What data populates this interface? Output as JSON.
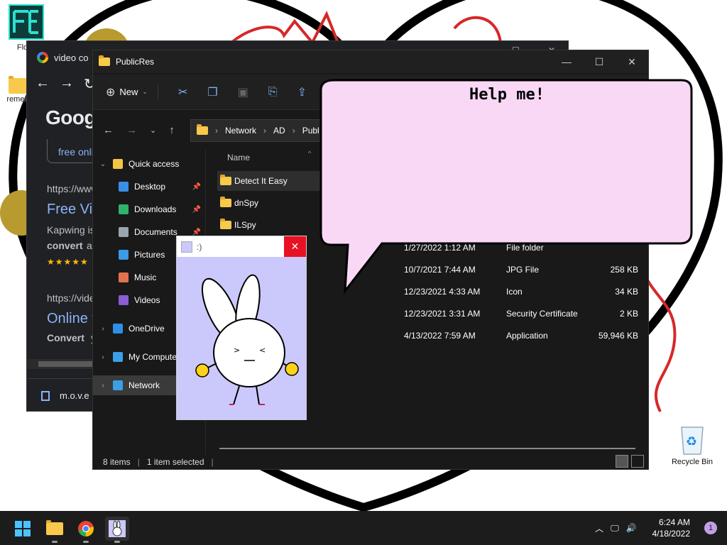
{
  "desktop": {
    "icons": [
      {
        "label": "Flowf",
        "icon": "flowframes-app-icon"
      },
      {
        "label": "remen",
        "icon": "folder-icon"
      }
    ],
    "recycle_bin": {
      "label": "Recycle Bin"
    }
  },
  "chrome": {
    "tab_title": "video co",
    "google_text": "Goog",
    "free_online": "free onli",
    "results": [
      {
        "url": "https://www",
        "title": "Free Vi",
        "snippet": "Kapwing is",
        "snippet_bold": "convert",
        "snippet_rest": "ar",
        "stars": "★★★★★"
      },
      {
        "url": "https://vide",
        "title": "Online v",
        "snippet_bold": "Convert",
        "snippet": "yo"
      }
    ],
    "download_item": "m.o.v.e"
  },
  "explorer": {
    "title": "PublicRes",
    "toolbar": {
      "new_label": "New"
    },
    "address": {
      "segments": [
        "Network",
        "AD",
        "Publi"
      ]
    },
    "nav": [
      {
        "label": "Quick access",
        "level": 0,
        "chevron": "down",
        "icon": "star-icon",
        "color": "#f4c542"
      },
      {
        "label": "Desktop",
        "level": 1,
        "pinned": true,
        "icon": "desktop-icon",
        "color": "#3a8ee6"
      },
      {
        "label": "Downloads",
        "level": 1,
        "pinned": true,
        "icon": "download-icon",
        "color": "#2fb36b"
      },
      {
        "label": "Documents",
        "level": 1,
        "pinned": true,
        "icon": "document-icon",
        "color": "#9aa5b1"
      },
      {
        "label": "Pictures",
        "level": 1,
        "icon": "pictures-icon",
        "color": "#3a9be6"
      },
      {
        "label": "Music",
        "level": 1,
        "icon": "music-icon",
        "color": "#e2724f"
      },
      {
        "label": "Videos",
        "level": 1,
        "icon": "videos-icon",
        "color": "#8a5cd6"
      },
      {
        "label": "OneDrive",
        "level": 0,
        "chevron": "right",
        "icon": "onedrive-icon",
        "color": "#2f8fe6"
      },
      {
        "label": "My Compute",
        "level": 0,
        "chevron": "right",
        "icon": "computer-icon",
        "color": "#3aa0e6"
      },
      {
        "label": "Network",
        "level": 0,
        "chevron": "right",
        "icon": "network-icon",
        "color": "#3aa0e6",
        "selected": true
      }
    ],
    "column_name": "Name",
    "files": [
      {
        "name": "Detect It Easy",
        "date": "",
        "type": "",
        "size": "",
        "selected": true
      },
      {
        "name": "dnSpy",
        "date": "",
        "type": "",
        "size": ""
      },
      {
        "name": "ILSpy",
        "date": "",
        "type": "",
        "size": ""
      },
      {
        "name": "",
        "date": "1/27/2022 1:12 AM",
        "type": "File folder",
        "size": ""
      },
      {
        "name": "",
        "date": "10/7/2021 7:44 AM",
        "type": "JPG File",
        "size": "258 KB"
      },
      {
        "name": "",
        "date": "12/23/2021 4:33 AM",
        "type": "Icon",
        "size": "34 KB"
      },
      {
        "name": "",
        "date": "12/23/2021 3:31 AM",
        "type": "Security Certificate",
        "size": "2 KB"
      },
      {
        "name": "",
        "date": "4/13/2022 7:59 AM",
        "type": "Application",
        "size": "59,946 KB"
      }
    ],
    "status": {
      "items": "8 items",
      "selected": "1 item selected"
    }
  },
  "popup": {
    "title": ":)"
  },
  "bubble": {
    "text": "Help me!"
  },
  "taskbar": {
    "time": "6:24 AM",
    "date": "4/18/2022",
    "notifications": "1"
  }
}
